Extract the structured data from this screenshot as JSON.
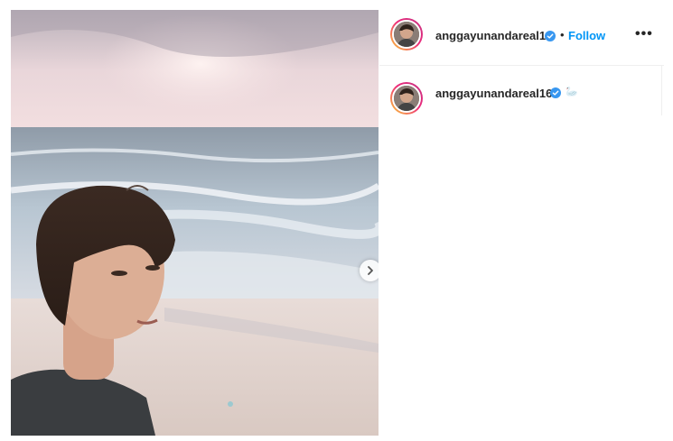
{
  "post": {
    "media_alt": "selfie-on-beach-at-sunset",
    "carousel_next_icon": "chevron-right-icon"
  },
  "header": {
    "username": "anggayunandareal16",
    "verified_icon": "verified-badge-icon",
    "separator": "•",
    "follow_label": "Follow",
    "more_label": "•••",
    "accent_color": "#0095f6"
  },
  "caption": {
    "username": "anggayunandareal16",
    "verified_icon": "verified-badge-icon",
    "emoji": "🦢"
  }
}
